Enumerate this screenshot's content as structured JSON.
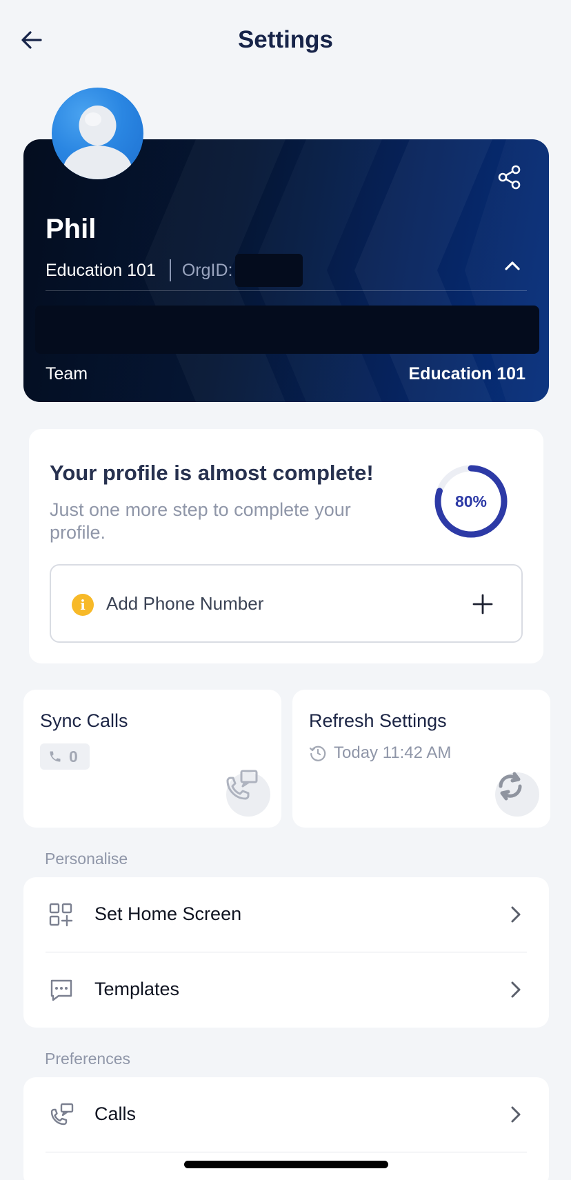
{
  "header": {
    "title": "Settings"
  },
  "profile": {
    "name": "Phil",
    "organization": "Education 101",
    "org_id_label": "OrgID:",
    "team_label": "Team",
    "team_value": "Education 101",
    "icons": {
      "avatar": "user-avatar-icon",
      "share": "share-icon",
      "collapse": "chevron-up-icon"
    }
  },
  "completion": {
    "title": "Your profile is almost complete!",
    "subtitle": "Just one more step to complete your profile.",
    "percent_label": "80%",
    "percent_value": 80,
    "phone_action_label": "Add Phone Number",
    "info_glyph": "i",
    "colors": {
      "ring": "#2d3aa6",
      "info": "#f7b928"
    }
  },
  "tiles": {
    "sync_calls": {
      "title": "Sync Calls",
      "count": "0"
    },
    "refresh_settings": {
      "title": "Refresh Settings",
      "time": "Today 11:42 AM"
    }
  },
  "sections": {
    "personalise": {
      "label": "Personalise",
      "items": [
        {
          "label": "Set Home Screen",
          "icon": "grid-add-icon"
        },
        {
          "label": "Templates",
          "icon": "message-dots-icon"
        }
      ]
    },
    "preferences": {
      "label": "Preferences",
      "items": [
        {
          "label": "Calls",
          "icon": "phone-sync-icon"
        }
      ]
    }
  }
}
